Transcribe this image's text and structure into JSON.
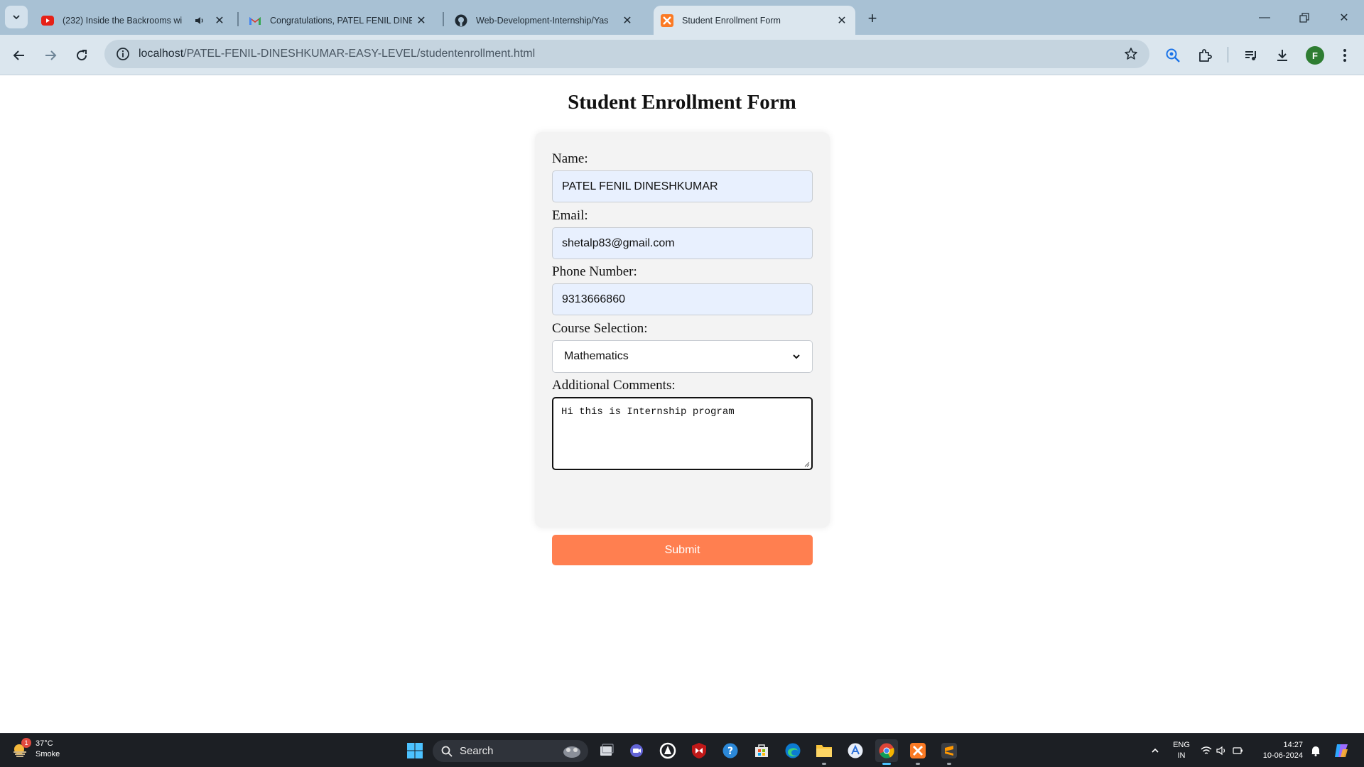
{
  "browser": {
    "tabs": [
      {
        "title": "(232) Inside the Backrooms wi",
        "icon": "youtube-icon"
      },
      {
        "title": "Congratulations, PATEL FENIL DINE",
        "icon": "gmail-icon"
      },
      {
        "title": "Web-Development-Internship/Yas",
        "icon": "github-icon"
      },
      {
        "title": "Student Enrollment Form",
        "icon": "xampp-icon"
      }
    ],
    "url_host": "localhost",
    "url_path": "/PATEL-FENIL-DINESHKUMAR-EASY-LEVEL/studentenrollment.html",
    "profile_initial": "F"
  },
  "page": {
    "heading": "Student Enrollment Form",
    "form": {
      "name_label": "Name:",
      "name_value": "PATEL FENIL DINESHKUMAR",
      "email_label": "Email:",
      "email_value": "shetalp83@gmail.com",
      "phone_label": "Phone Number:",
      "phone_value": "9313666860",
      "course_label": "Course Selection:",
      "course_value": "Mathematics",
      "comments_label": "Additional Comments:",
      "comments_value": "Hi this is Internship program",
      "submit_label": "Submit"
    },
    "colors": {
      "accent": "#ff7f50",
      "autofill": "#e8f0fe"
    }
  },
  "taskbar": {
    "weather_temp": "37°C",
    "weather_desc": "Smoke",
    "weather_badge": "1",
    "search_label": "Search",
    "lang_line1": "ENG",
    "lang_line2": "IN",
    "time": "14:27",
    "date": "10-06-2024"
  }
}
